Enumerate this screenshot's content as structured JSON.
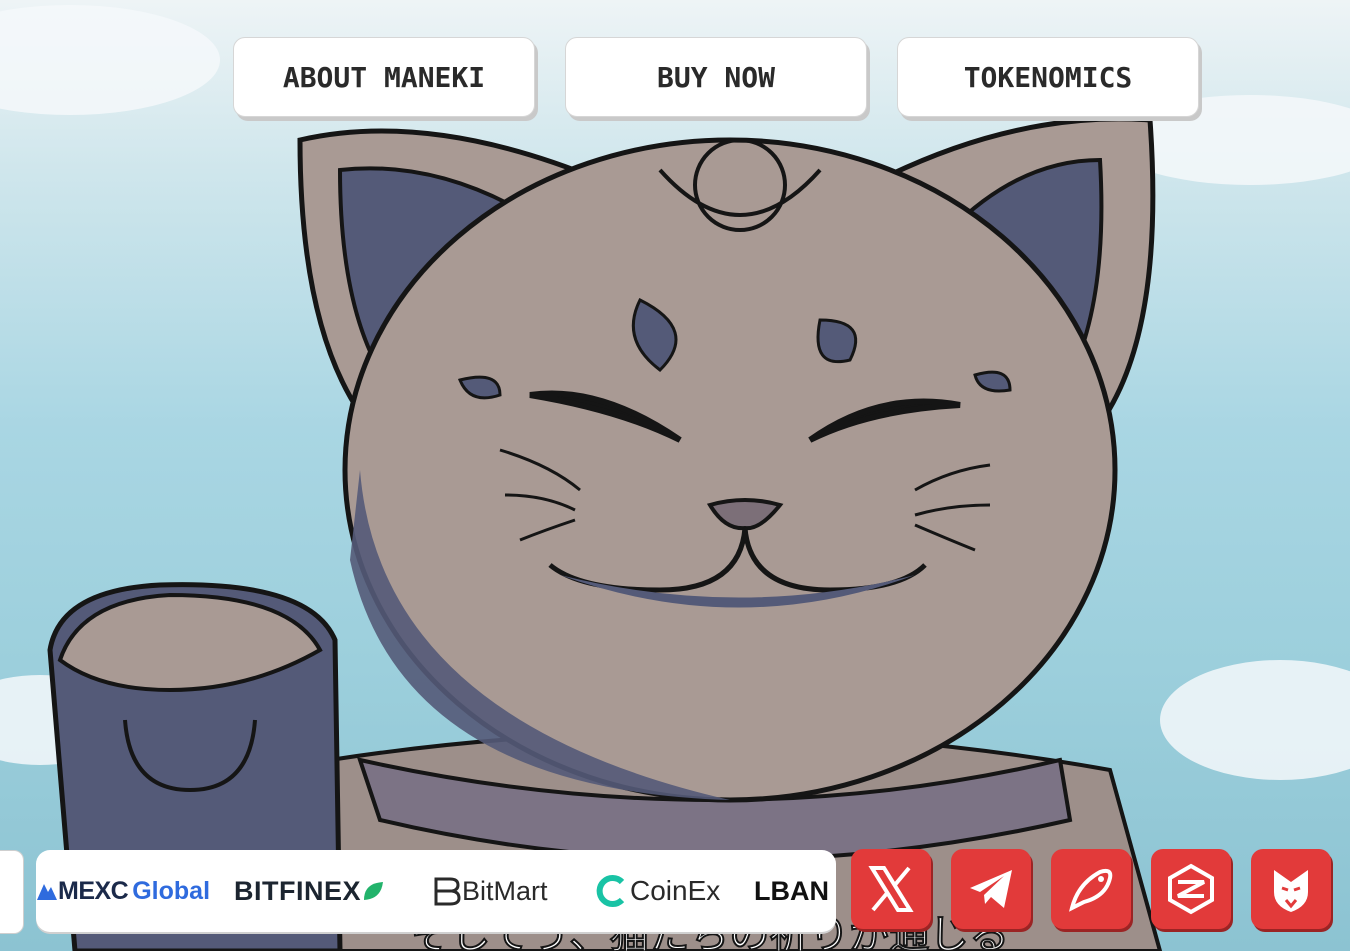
{
  "nav": {
    "about_label": "ABOUT MANEKI",
    "buy_label": "BUY NOW",
    "tokenomics_label": "TOKENOMICS"
  },
  "exchanges": {
    "mexc_part1": "MEXC",
    "mexc_part2": "Global",
    "bitfinex": "BITFINEX",
    "bitmart": "BitMart",
    "coinex": "CoinEx",
    "lbank": "LBAN"
  },
  "socials": {
    "icons": [
      "x-icon",
      "telegram-icon",
      "birdeye-icon",
      "dextools-icon",
      "eagle-icon"
    ]
  },
  "subtitle": "そしてう、猫たちの祈りが通じる",
  "colors": {
    "social_red": "#e23a3a",
    "sky": "#a9d6e3",
    "cat_fur": "#a99a94",
    "cat_shadow": "#545a78",
    "mexc_blue": "#2f6bde",
    "bitfinex_green": "#22b36b",
    "coinex_teal": "#19c3a5"
  }
}
